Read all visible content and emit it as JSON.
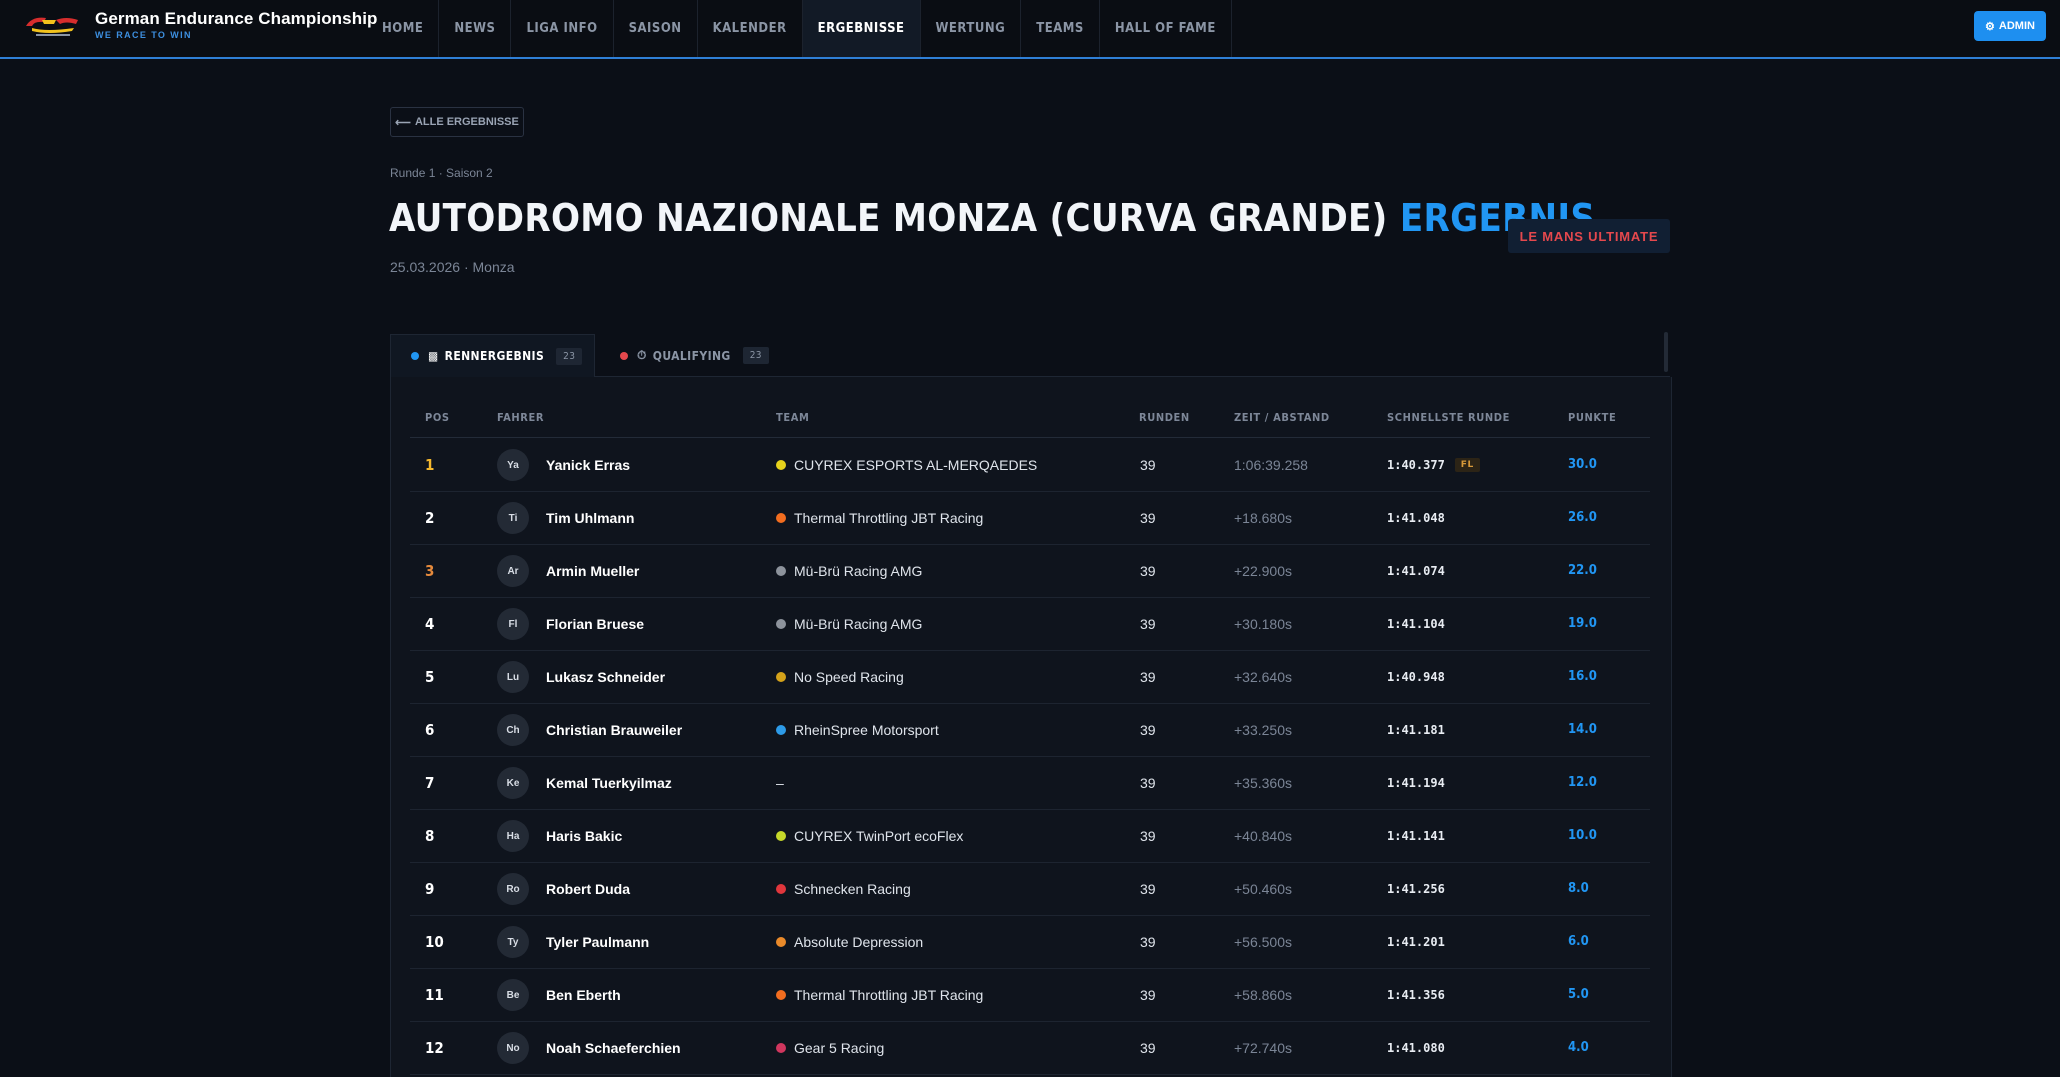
{
  "brand": {
    "title": "German Endurance Championship",
    "subtitle": "WE RACE TO WIN",
    "logo_text": "GEC"
  },
  "nav": {
    "items": [
      "HOME",
      "NEWS",
      "LIGA INFO",
      "SAISON",
      "KALENDER",
      "ERGEBNISSE",
      "WERTUNG",
      "TEAMS",
      "HALL OF FAME"
    ],
    "active": "ERGEBNISSE"
  },
  "admin_label": "ADMIN",
  "back_label": "ALLE ERGEBNISSE",
  "breadcrumb": "Runde 1 · Saison 2",
  "title": {
    "main": "AUTODROMO NAZIONALE MONZA (CURVA GRANDE)",
    "highlight": "ERGEBNIS"
  },
  "date_line": "25.03.2026 · Monza",
  "game_badge": "LE MANS ULTIMATE",
  "tabs": [
    {
      "label": "RENNERGEBNIS",
      "count": "23",
      "dot_color": "#2196f3",
      "icon": "checkered-flag-icon"
    },
    {
      "label": "QUALIFYING",
      "count": "23",
      "dot_color": "#e5484d",
      "icon": "stopwatch-icon"
    }
  ],
  "columns": {
    "pos": "POS",
    "driver": "FAHRER",
    "team": "TEAM",
    "laps": "RUNDEN",
    "time": "ZEIT / ABSTAND",
    "fastest": "SCHNELLSTE RUNDE",
    "points": "PUNKTE"
  },
  "fastest_lap_badge": "FL",
  "results": [
    {
      "pos": "1",
      "initials": "Ya",
      "driver": "Yanick Erras",
      "team": "CUYREX ESPORTS AL-MERQAEDES",
      "team_color": "#e6d21c",
      "laps": "39",
      "time": "1:06:39.258",
      "fastest": "1:40.377",
      "fl": true,
      "points": "30.0"
    },
    {
      "pos": "2",
      "initials": "Ti",
      "driver": "Tim Uhlmann",
      "team": "Thermal Throttling JBT Racing",
      "team_color": "#f26d1f",
      "laps": "39",
      "time": "+18.680s",
      "fastest": "1:41.048",
      "fl": false,
      "points": "26.0"
    },
    {
      "pos": "3",
      "initials": "Ar",
      "driver": "Armin Mueller",
      "team": "Mü-Brü Racing AMG",
      "team_color": "#8d939c",
      "laps": "39",
      "time": "+22.900s",
      "fastest": "1:41.074",
      "fl": false,
      "points": "22.0"
    },
    {
      "pos": "4",
      "initials": "Fl",
      "driver": "Florian Bruese",
      "team": "Mü-Brü Racing AMG",
      "team_color": "#8d939c",
      "laps": "39",
      "time": "+30.180s",
      "fastest": "1:41.104",
      "fl": false,
      "points": "19.0"
    },
    {
      "pos": "5",
      "initials": "Lu",
      "driver": "Lukasz Schneider",
      "team": "No Speed Racing",
      "team_color": "#d4a21a",
      "laps": "39",
      "time": "+32.640s",
      "fastest": "1:40.948",
      "fl": false,
      "points": "16.0"
    },
    {
      "pos": "6",
      "initials": "Ch",
      "driver": "Christian Brauweiler",
      "team": "RheinSpree Motorsport",
      "team_color": "#2d9be8",
      "laps": "39",
      "time": "+33.250s",
      "fastest": "1:41.181",
      "fl": false,
      "points": "14.0"
    },
    {
      "pos": "7",
      "initials": "Ke",
      "driver": "Kemal Tuerkyilmaz",
      "team": "–",
      "team_color": "",
      "laps": "39",
      "time": "+35.360s",
      "fastest": "1:41.194",
      "fl": false,
      "points": "12.0"
    },
    {
      "pos": "8",
      "initials": "Ha",
      "driver": "Haris Bakic",
      "team": "CUYREX TwinPort ecoFlex",
      "team_color": "#c6d82a",
      "laps": "39",
      "time": "+40.840s",
      "fastest": "1:41.141",
      "fl": false,
      "points": "10.0"
    },
    {
      "pos": "9",
      "initials": "Ro",
      "driver": "Robert Duda",
      "team": "Schnecken Racing",
      "team_color": "#e0363c",
      "laps": "39",
      "time": "+50.460s",
      "fastest": "1:41.256",
      "fl": false,
      "points": "8.0"
    },
    {
      "pos": "10",
      "initials": "Ty",
      "driver": "Tyler Paulmann",
      "team": "Absolute Depression",
      "team_color": "#ea8a2a",
      "laps": "39",
      "time": "+56.500s",
      "fastest": "1:41.201",
      "fl": false,
      "points": "6.0"
    },
    {
      "pos": "11",
      "initials": "Be",
      "driver": "Ben Eberth",
      "team": "Thermal Throttling JBT Racing",
      "team_color": "#f26d1f",
      "laps": "39",
      "time": "+58.860s",
      "fastest": "1:41.356",
      "fl": false,
      "points": "5.0"
    },
    {
      "pos": "12",
      "initials": "No",
      "driver": "Noah Schaeferchien",
      "team": "Gear 5 Racing",
      "team_color": "#d0365e",
      "laps": "39",
      "time": "+72.740s",
      "fastest": "1:41.080",
      "fl": false,
      "points": "4.0"
    }
  ]
}
